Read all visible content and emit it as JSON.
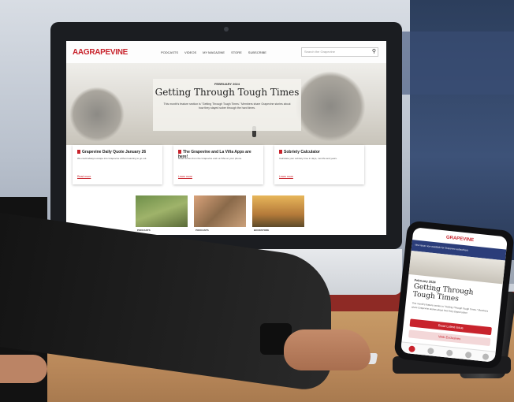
{
  "website": {
    "logo": "AAGRAPEVINE",
    "nav": [
      "PODCASTS",
      "VIDEOS",
      "MY MAGAZINE",
      "STORE",
      "SUBSCRIBE"
    ],
    "search_placeholder": "Search the Grapevine",
    "hero": {
      "date": "FEBRUARY 2024",
      "title": "Getting Through Tough Times",
      "description": "This month's feature section is \"Getting Through Tough Times.\" Members share Grapevine stories about how they stayed sober through the hard times."
    },
    "cards": [
      {
        "title": "Grapevine Daily Quote January 26",
        "body": "We could always escape into Grapevine without wanting to go out.",
        "link": "Read more"
      },
      {
        "title": "The Grapevine and La Viña Apps are here!",
        "body": "Read stories from the Grapevine and La Viña on your phone.",
        "link": "Learn more"
      },
      {
        "title": "Sobriety Calculator",
        "body": "Calculate your sobriety time in days, months and years.",
        "link": "Learn more"
      }
    ],
    "thumbnails": [
      "PODCASTS",
      "PODCASTS",
      "BOOKSTORE"
    ]
  },
  "phone": {
    "logo": "GRAPEVINE",
    "banner": "New issue now available for Grapevine subscribers",
    "date": "February 2024",
    "title": "Getting Through Tough Times",
    "description": "This month's feature section is \"Getting Through Tough Times.\" Members share Grapevine stories about how they stayed sober.",
    "primary_button": "Read Latest Issue",
    "secondary_button": "Web Exclusives"
  },
  "colors": {
    "brand_red": "#c8232c",
    "banner_blue": "#2b3d7a",
    "desk": "#b9885a"
  }
}
